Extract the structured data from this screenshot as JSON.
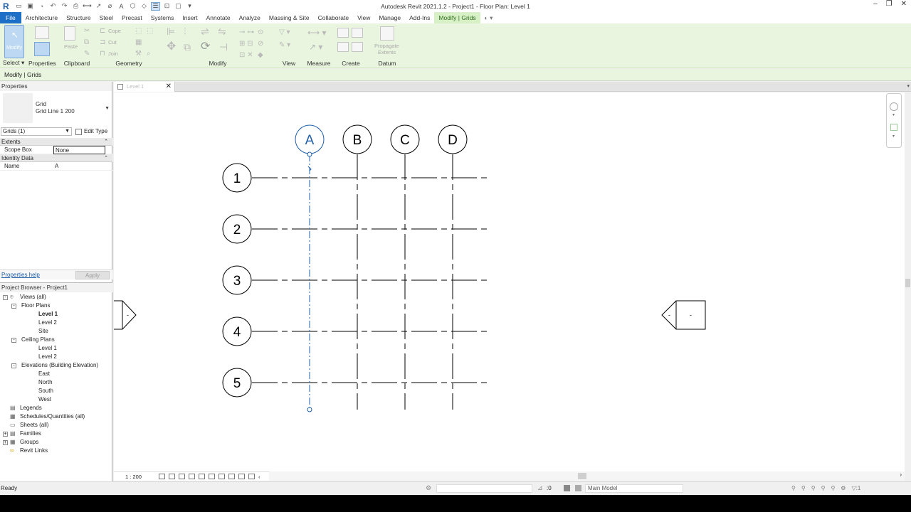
{
  "app": {
    "title": "Autodesk Revit 2021.1.2 - Project1 - Floor Plan: Level 1",
    "logo": "R"
  },
  "menu": {
    "tabs": [
      "File",
      "Architecture",
      "Structure",
      "Steel",
      "Precast",
      "Systems",
      "Insert",
      "Annotate",
      "Analyze",
      "Massing & Site",
      "Collaborate",
      "View",
      "Manage",
      "Add-Ins",
      "Modify | Grids"
    ]
  },
  "ribbon": {
    "groups": {
      "select": "Select",
      "properties": "Properties",
      "clipboard": "Clipboard",
      "geometry": "Geometry",
      "modify": "Modify",
      "view": "View",
      "measure": "Measure",
      "create": "Create",
      "datum": "Datum"
    },
    "modify_button": "Modify",
    "paste": "Paste",
    "cope": "Cope",
    "cut": "Cut",
    "join": "Join",
    "propagate_line1": "Propagate",
    "propagate_line2": "Extents"
  },
  "options_bar": {
    "label": "Modify | Grids"
  },
  "properties": {
    "panel_title": "Properties",
    "type_family": "Grid",
    "type_name": "Grid Line 1 200",
    "instance_filter": "Grids (1)",
    "edit_type": "Edit Type",
    "categories": [
      {
        "name": "Extents",
        "rows": [
          {
            "key": "Scope Box",
            "value": "None"
          }
        ]
      },
      {
        "name": "Identity Data",
        "rows": [
          {
            "key": "Name",
            "value": "A"
          }
        ]
      }
    ],
    "help_link": "Properties help",
    "apply": "Apply"
  },
  "project_browser": {
    "title": "Project Browser - Project1",
    "nodes": [
      {
        "label": "Views (all)",
        "level": 0,
        "toggle": "-",
        "icon": "views-icon"
      },
      {
        "label": "Floor Plans",
        "level": 1,
        "toggle": "-"
      },
      {
        "label": "Level 1",
        "level": 2,
        "bold": true
      },
      {
        "label": "Level 2",
        "level": 2
      },
      {
        "label": "Site",
        "level": 2
      },
      {
        "label": "Ceiling Plans",
        "level": 1,
        "toggle": "-"
      },
      {
        "label": "Level 1",
        "level": 2
      },
      {
        "label": "Level 2",
        "level": 2
      },
      {
        "label": "Elevations (Building Elevation)",
        "level": 1,
        "toggle": "-"
      },
      {
        "label": "East",
        "level": 2
      },
      {
        "label": "North",
        "level": 2
      },
      {
        "label": "South",
        "level": 2
      },
      {
        "label": "West",
        "level": 2
      },
      {
        "label": "Legends",
        "level": 0,
        "icon": "legend-icon"
      },
      {
        "label": "Schedules/Quantities (all)",
        "level": 0,
        "icon": "schedule-icon"
      },
      {
        "label": "Sheets (all)",
        "level": 0,
        "icon": "sheet-icon"
      },
      {
        "label": "Families",
        "level": 0,
        "toggle": "+",
        "icon": "family-icon"
      },
      {
        "label": "Groups",
        "level": 0,
        "toggle": "+",
        "icon": "group-icon"
      },
      {
        "label": "Revit Links",
        "level": 0,
        "icon": "link-icon"
      }
    ]
  },
  "view_tab": {
    "label": "Level 1"
  },
  "drawing": {
    "vertical_grids": [
      "A",
      "B",
      "C",
      "D"
    ],
    "horizontal_grids": [
      "1",
      "2",
      "3",
      "4",
      "5"
    ],
    "selected_grid": "A",
    "elevation_marker_left": "-",
    "elevation_marker_right": "-",
    "selection_color": "#1f5fa8"
  },
  "view_control": {
    "scale": "1 : 200"
  },
  "status": {
    "text": "Ready",
    "count": ":0",
    "model": "Main Model",
    "filter_count": ":1"
  }
}
